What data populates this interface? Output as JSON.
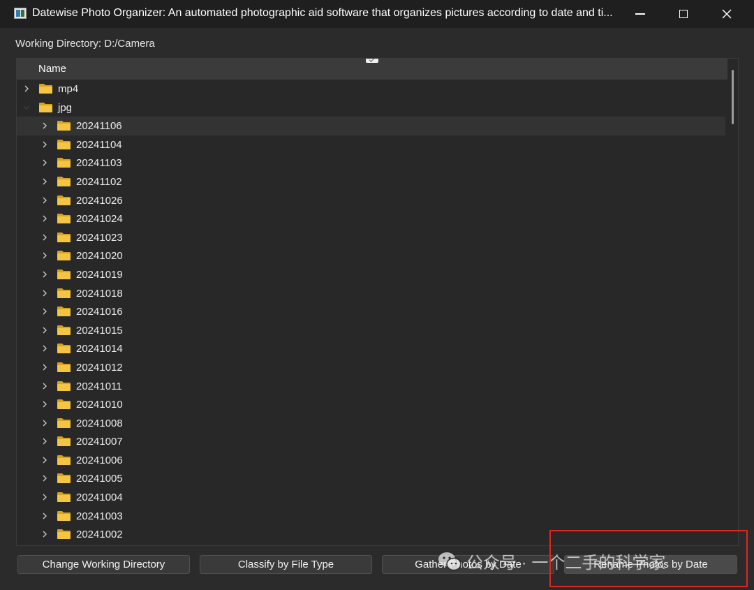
{
  "window": {
    "title": "Datewise Photo Organizer: An automated photographic aid software that organizes pictures according to date and ti..."
  },
  "working_directory": {
    "label": "Working Directory: D:/Camera"
  },
  "tree": {
    "column_header": "Name",
    "items": [
      {
        "label": "mp4",
        "level": 0,
        "expanded": false
      },
      {
        "label": "jpg",
        "level": 0,
        "expanded": true
      },
      {
        "label": "20241106",
        "level": 1,
        "expanded": false,
        "selected": true
      },
      {
        "label": "20241104",
        "level": 1,
        "expanded": false
      },
      {
        "label": "20241103",
        "level": 1,
        "expanded": false
      },
      {
        "label": "20241102",
        "level": 1,
        "expanded": false
      },
      {
        "label": "20241026",
        "level": 1,
        "expanded": false
      },
      {
        "label": "20241024",
        "level": 1,
        "expanded": false
      },
      {
        "label": "20241023",
        "level": 1,
        "expanded": false
      },
      {
        "label": "20241020",
        "level": 1,
        "expanded": false
      },
      {
        "label": "20241019",
        "level": 1,
        "expanded": false
      },
      {
        "label": "20241018",
        "level": 1,
        "expanded": false
      },
      {
        "label": "20241016",
        "level": 1,
        "expanded": false
      },
      {
        "label": "20241015",
        "level": 1,
        "expanded": false
      },
      {
        "label": "20241014",
        "level": 1,
        "expanded": false
      },
      {
        "label": "20241012",
        "level": 1,
        "expanded": false
      },
      {
        "label": "20241011",
        "level": 1,
        "expanded": false
      },
      {
        "label": "20241010",
        "level": 1,
        "expanded": false
      },
      {
        "label": "20241008",
        "level": 1,
        "expanded": false
      },
      {
        "label": "20241007",
        "level": 1,
        "expanded": false
      },
      {
        "label": "20241006",
        "level": 1,
        "expanded": false
      },
      {
        "label": "20241005",
        "level": 1,
        "expanded": false
      },
      {
        "label": "20241004",
        "level": 1,
        "expanded": false
      },
      {
        "label": "20241003",
        "level": 1,
        "expanded": false
      },
      {
        "label": "20241002",
        "level": 1,
        "expanded": false
      }
    ]
  },
  "buttons": {
    "change_dir": "Change Working Directory",
    "classify": "Classify by File Type",
    "gather": "Gather Photos by Date",
    "rename": "Rename Photos by Date"
  },
  "watermark": {
    "text": "公众号 · 一个二手的科学家"
  },
  "colors": {
    "folder": "#f4c542",
    "highlight": "#e0261f",
    "background": "#2b2b2b"
  },
  "icons": {
    "app": "app-icon",
    "folder": "folder-icon",
    "collapsed": "chevron-right-icon",
    "expanded": "chevron-down-icon"
  }
}
